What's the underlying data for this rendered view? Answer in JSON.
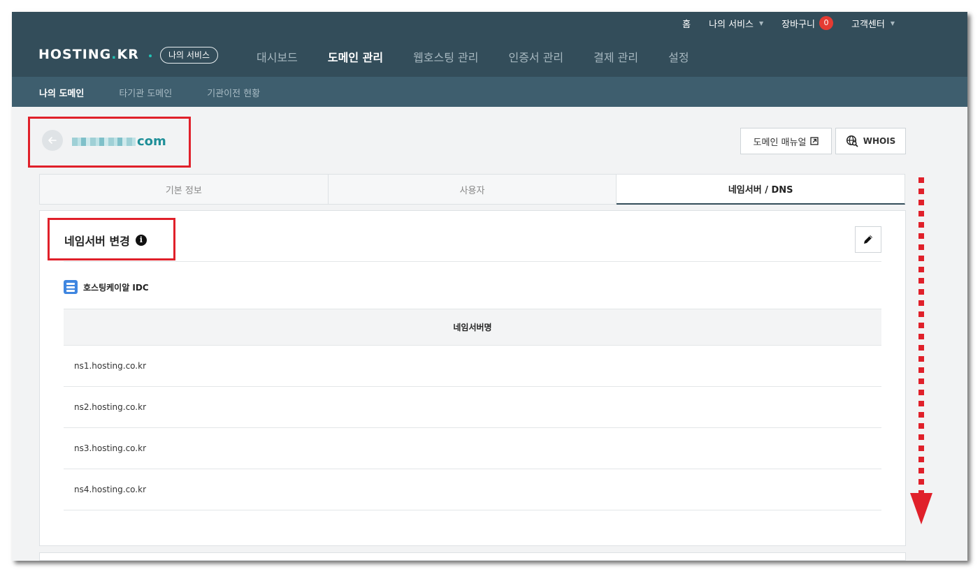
{
  "header": {
    "util_links": {
      "home": "홈",
      "my_services": "나의 서비스",
      "cart": "장바구니",
      "cart_count": "0",
      "support": "고객센터"
    },
    "logo": {
      "main": "HOSTING",
      "dot": ".",
      "tld": "KR"
    },
    "my_service_pill": "나의 서비스",
    "nav": [
      {
        "label": "대시보드",
        "active": false
      },
      {
        "label": "도메인 관리",
        "active": true
      },
      {
        "label": "웹호스팅 관리",
        "active": false
      },
      {
        "label": "인증서 관리",
        "active": false
      },
      {
        "label": "결제 관리",
        "active": false
      },
      {
        "label": "설정",
        "active": false
      }
    ],
    "subnav": [
      {
        "label": "나의 도메인",
        "active": true
      },
      {
        "label": "타기관 도메인",
        "active": false
      },
      {
        "label": "기관이전 현황",
        "active": false
      }
    ]
  },
  "domain": {
    "suffix": "com"
  },
  "buttons": {
    "manual": "도메인 매뉴얼",
    "whois": "WHOIS"
  },
  "tabs": [
    {
      "label": "기본 정보",
      "active": false
    },
    {
      "label": "사용자",
      "active": false
    },
    {
      "label": "네임서버 / DNS",
      "active": true
    }
  ],
  "nameserver_panel": {
    "title": "네임서버 변경",
    "provider": "호스팅케이알 IDC",
    "column_header": "네임서버명",
    "rows": [
      "ns1.hosting.co.kr",
      "ns2.hosting.co.kr",
      "ns3.hosting.co.kr",
      "ns4.hosting.co.kr"
    ]
  },
  "colors": {
    "header_bg": "#334d5a",
    "subnav_bg": "#3e5e6e",
    "accent_teal": "#1f8f98",
    "annotation_red": "#e0202a",
    "badge_red": "#e53b32"
  }
}
